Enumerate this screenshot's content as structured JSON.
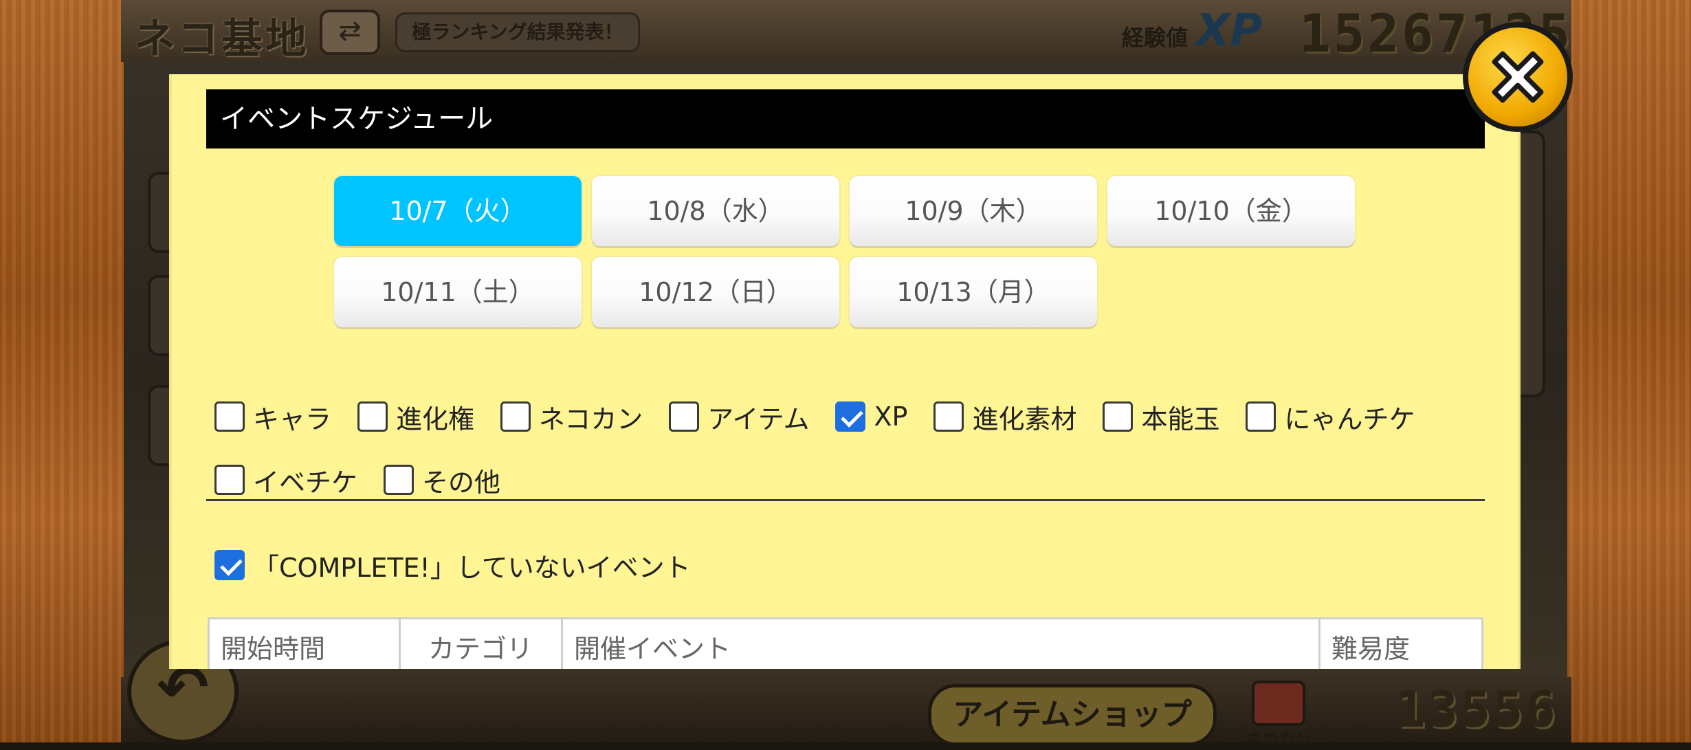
{
  "background": {
    "screen_title": "ネコ基地",
    "ticker_text": "極ランキング結果発表！",
    "xp_label": "経験値",
    "xp_word": "XP",
    "xp_value": "15267125",
    "item_shop_label": "アイテムショップ",
    "nekokan_label": "ネコカン",
    "nekokan_value": "13556"
  },
  "modal": {
    "title": "イベントスケジュール",
    "dates": [
      {
        "label": "10/7（火）",
        "active": true
      },
      {
        "label": "10/8（水）",
        "active": false
      },
      {
        "label": "10/9（木）",
        "active": false
      },
      {
        "label": "10/10（金）",
        "active": false
      },
      {
        "label": "10/11（土）",
        "active": false
      },
      {
        "label": "10/12（日）",
        "active": false
      },
      {
        "label": "10/13（月）",
        "active": false
      }
    ],
    "filters": [
      {
        "label": "キャラ",
        "checked": false
      },
      {
        "label": "進化権",
        "checked": false
      },
      {
        "label": "ネコカン",
        "checked": false
      },
      {
        "label": "アイテム",
        "checked": false
      },
      {
        "label": "XP",
        "checked": true
      },
      {
        "label": "進化素材",
        "checked": false
      },
      {
        "label": "本能玉",
        "checked": false
      },
      {
        "label": "にゃんチケ",
        "checked": false
      },
      {
        "label": "イベチケ",
        "checked": false
      },
      {
        "label": "その他",
        "checked": false
      }
    ],
    "incomplete_filter": {
      "label": "「COMPLETE!」していないイベント",
      "checked": true
    },
    "table_headers": [
      "開始時間",
      "カテゴリ",
      "開催イベント",
      "難易度"
    ]
  },
  "colors": {
    "modal_bg": "#fff594",
    "active_date": "#00c4ff",
    "checkbox_on": "#1d6fe0"
  }
}
